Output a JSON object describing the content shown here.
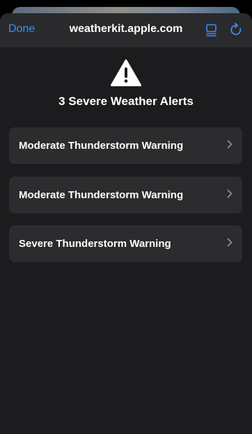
{
  "nav": {
    "done_label": "Done",
    "title": "weatherkit.apple.com",
    "reader_icon": "reader-mode-icon",
    "reload_icon": "reload-icon"
  },
  "alerts_heading": "3 Severe Weather Alerts",
  "alert_icon": "warning-triangle-icon",
  "alerts": [
    {
      "label": "Moderate Thunderstorm Warning"
    },
    {
      "label": "Moderate Thunderstorm Warning"
    },
    {
      "label": "Severe Thunderstorm Warning"
    }
  ],
  "colors": {
    "accent": "#3e8cf4",
    "sheet_background": "#1c1c1e",
    "card_background": "#2c2c2e",
    "text": "#ffffff"
  }
}
